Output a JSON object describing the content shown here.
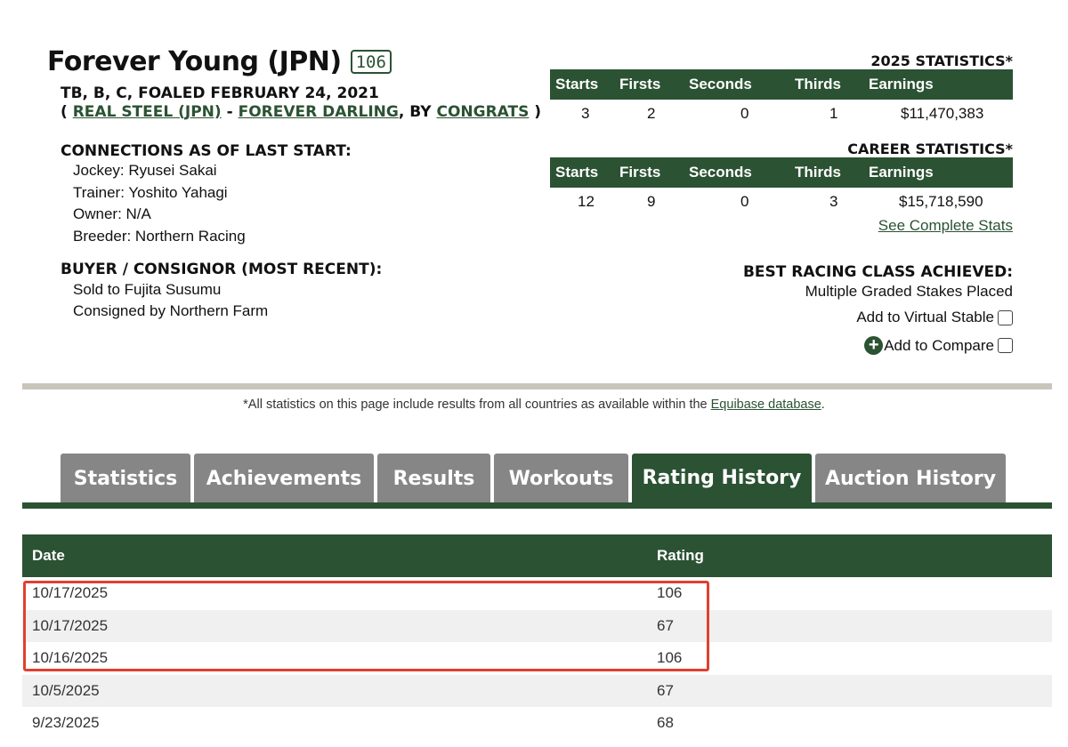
{
  "horse": {
    "name": "Forever Young (JPN)",
    "rating": "106",
    "description": "TB, B, C, FOALED FEBRUARY 24, 2021",
    "paren_open": "( ",
    "sire": "REAL STEEL (JPN)",
    "sep": " - ",
    "dam": "FOREVER DARLING",
    "by_text": ", BY ",
    "damsire": "CONGRATS",
    "paren_close": " )"
  },
  "connections": {
    "title": "CONNECTIONS AS OF LAST START:",
    "jockey": "Jockey: Ryusei Sakai",
    "trainer": "Trainer: Yoshito Yahagi",
    "owner": "Owner: N/A",
    "breeder": "Breeder: Northern Racing"
  },
  "buyer": {
    "title": "BUYER / CONSIGNOR (MOST RECENT):",
    "sold": "Sold to Fujita Susumu",
    "consigned": "Consigned by Northern Farm"
  },
  "stats_headers": [
    "Starts",
    "Firsts",
    "Seconds",
    "Thirds",
    "Earnings"
  ],
  "stats_2025": {
    "title": "2025 STATISTICS*",
    "values": [
      "3",
      "2",
      "0",
      "1",
      "$11,470,383"
    ]
  },
  "stats_career": {
    "title": "CAREER STATISTICS*",
    "values": [
      "12",
      "9",
      "0",
      "3",
      "$15,718,590"
    ]
  },
  "see_complete_stats": "See Complete Stats",
  "best_class": {
    "title": "BEST RACING CLASS ACHIEVED:",
    "value": "Multiple Graded Stakes Placed"
  },
  "actions": {
    "virtual_stable": "Add to Virtual Stable",
    "compare": "Add to Compare"
  },
  "disclaimer": {
    "text": "*All statistics on this page include results from all countries as available within the ",
    "link": "Equibase database",
    "end": "."
  },
  "tabs": [
    {
      "label": "Statistics",
      "active": false
    },
    {
      "label": "Achievements",
      "active": false
    },
    {
      "label": "Results",
      "active": false
    },
    {
      "label": "Workouts",
      "active": false
    },
    {
      "label": "Rating History",
      "active": true
    },
    {
      "label": "Auction History",
      "active": false
    }
  ],
  "rating_history": {
    "headers": [
      "Date",
      "Rating"
    ],
    "rows": [
      {
        "date": "10/17/2025",
        "rating": "106"
      },
      {
        "date": "10/17/2025",
        "rating": "67"
      },
      {
        "date": "10/16/2025",
        "rating": "106"
      },
      {
        "date": "10/5/2025",
        "rating": "67"
      },
      {
        "date": "9/23/2025",
        "rating": "68"
      }
    ]
  },
  "colors": {
    "brand_green": "#2b5233",
    "tab_gray": "#868686",
    "highlight_red": "#e0402f"
  }
}
